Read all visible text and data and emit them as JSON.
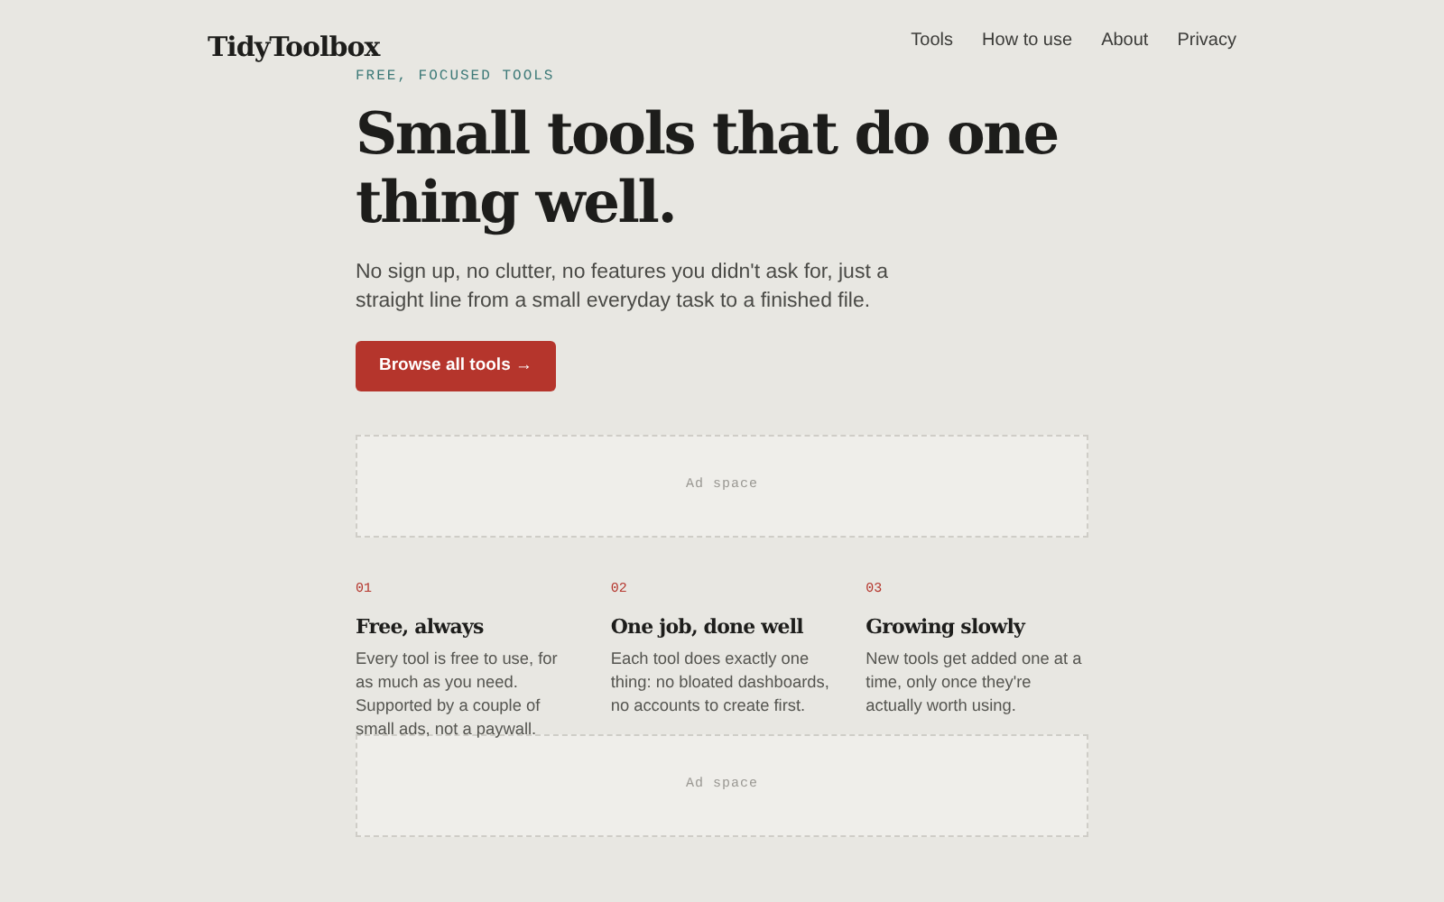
{
  "brand": "TidyToolbox",
  "nav": [
    "Tools",
    "How to use",
    "About",
    "Privacy"
  ],
  "hero": {
    "eyebrow": "FREE, FOCUSED TOOLS",
    "title": "Small tools that do one thing well.",
    "lead": "No sign up, no clutter, no features you didn't ask for, just a straight line from a small everyday task to a finished file.",
    "button": "Browse all tools →"
  },
  "ads": [
    "Ad space",
    "Ad space"
  ],
  "features": [
    {
      "number": "01",
      "title": "Free, always",
      "text": "Every tool is free to use, for as much as you need. Supported by a couple of small ads, not a paywall."
    },
    {
      "number": "02",
      "title": "One job, done well",
      "text": "Each tool does exactly one thing: no bloated dashboards, no accounts to create first."
    },
    {
      "number": "03",
      "title": "Growing slowly",
      "text": "New tools get added one at a time, only once they're actually worth using."
    }
  ]
}
